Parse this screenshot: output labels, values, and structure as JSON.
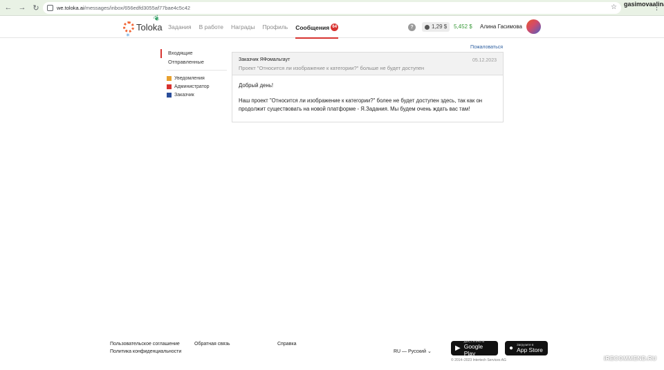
{
  "browser": {
    "url_host": "we.toloka.ai",
    "url_path": "/messages/inbox/656edfd3055af77bae4c5c42",
    "profile_name": "gasimovaalina"
  },
  "header": {
    "logo_text": "Toloka",
    "menu": [
      {
        "label": "Задания"
      },
      {
        "label": "В работе"
      },
      {
        "label": "Награды"
      },
      {
        "label": "Профиль"
      },
      {
        "label": "Сообщения",
        "badge": "64",
        "active": true
      }
    ],
    "help_label": "?",
    "balance_secondary": "1,29 $",
    "balance_main": "5,452 $",
    "user_name": "Алина Гасимова"
  },
  "sidebar": {
    "folders": [
      {
        "label": "Входящие",
        "active": true
      },
      {
        "label": "Отправленные"
      }
    ],
    "filters": [
      {
        "label": "Уведомления",
        "color": "#e8a02e"
      },
      {
        "label": "Администратор",
        "color": "#d7322f"
      },
      {
        "label": "Заказчик",
        "color": "#2a4d9a"
      }
    ]
  },
  "message": {
    "report_link": "Пожаловаться",
    "sender": "Заказчик ЯФомальгаут",
    "subject": "Проект \"Относится ли изображение к категории?\" больше не будет доступен",
    "date": "05.12.2023",
    "greeting": "Добрый день!",
    "body": "Наш проект \"Относится ли изображение к категории?\" более не будет доступен здесь, так как он продолжит существовать на новой платформе - Я.Задания. Мы будем очень ждать вас там!"
  },
  "footer": {
    "links": [
      "Пользовательское соглашение",
      "Обратная связь",
      "Справка",
      "Политика конфиденциальности"
    ],
    "language": "RU — Русский",
    "google_play_small": "ДОСТУПНО В",
    "google_play": "Google Play",
    "app_store_small": "Загрузите в",
    "app_store": "App Store",
    "copyright": "© 2014–2023 Intertech Services AG",
    "watermark": "iRECOMMEND.RU"
  }
}
